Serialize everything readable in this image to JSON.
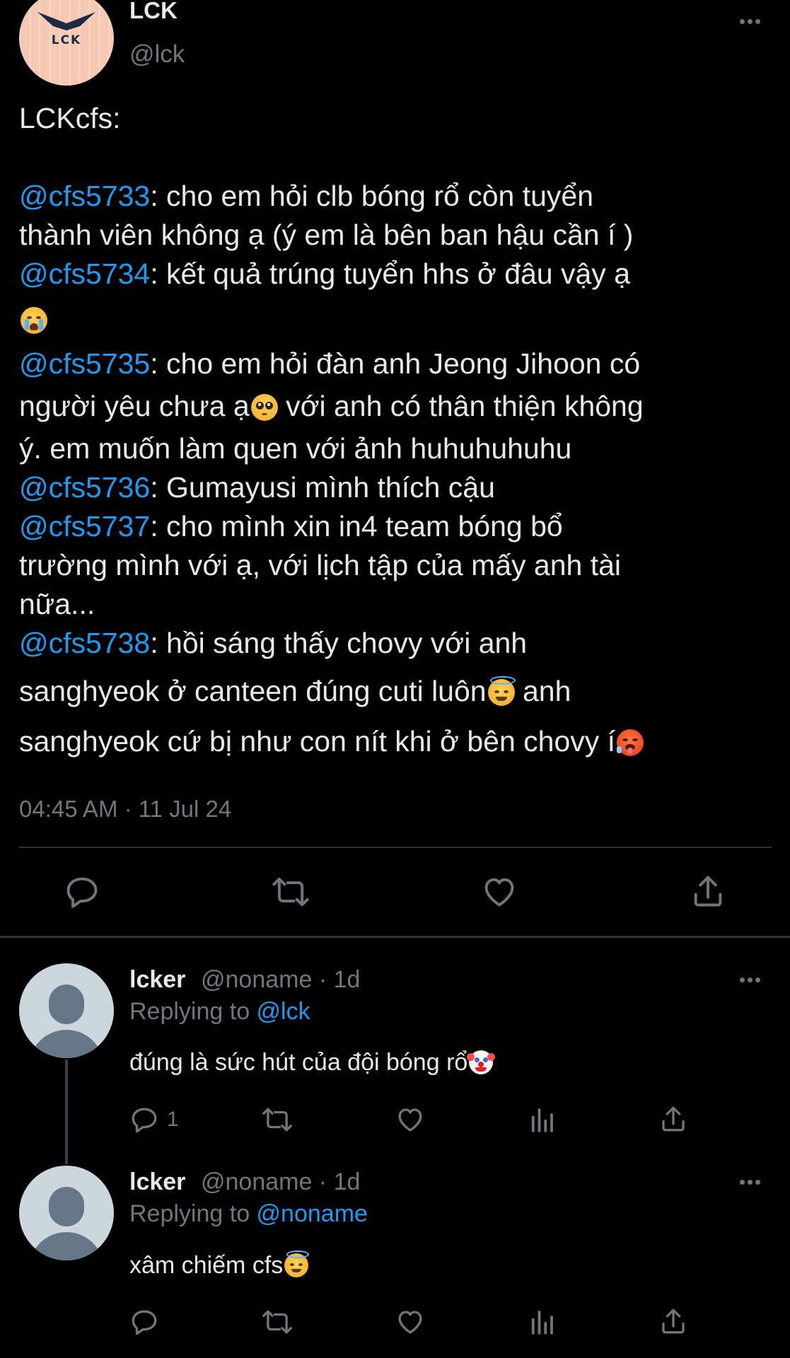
{
  "main_tweet": {
    "avatar_text": "LCK",
    "name": "LCK",
    "handle": "@lck",
    "header": "LCKcfs:",
    "lines": [
      {
        "mention": "@cfs5733",
        "text": ": cho em hỏi clb bóng rổ còn tuyển"
      },
      {
        "text": "thành viên không ạ (ý em là bên ban hậu cần í )"
      },
      {
        "mention": "@cfs5734",
        "text": ": kết quả trúng tuyển hhs ở đâu vậy ạ"
      },
      {
        "mention": "@cfs5735",
        "text": ": cho em hỏi đàn anh Jeong Jihoon có"
      },
      {
        "text": "người yêu chưa ạ",
        "text2": " với anh có thân thiện không"
      },
      {
        "text": "ý. em muốn làm quen với ảnh huhuhuhuhu"
      },
      {
        "mention": "@cfs5736",
        "text": ": Gumayusi mình thích cậu"
      },
      {
        "mention": "@cfs5737",
        "text": ": cho mình xin in4 team bóng bổ"
      },
      {
        "text": "trường mình với ạ, với lịch tập của mấy anh tài"
      },
      {
        "text": "nữa..."
      },
      {
        "mention": "@cfs5738",
        "text": ": hồi sáng thấy chovy với anh"
      },
      {
        "text": "sanghyeok ở canteen đúng cuti luôn",
        "text2": " anh"
      },
      {
        "text": "sanghyeok cứ bị như con nít khi ở bên chovy í"
      }
    ],
    "timestamp": "04:45 AM · 11 Jul 24",
    "icons": {
      "reply": "reply-icon",
      "retweet": "retweet-icon",
      "like": "like-icon",
      "share": "share-icon"
    }
  },
  "replies": [
    {
      "name": "lcker",
      "meta": "@noname · 1d",
      "replying_prefix": "Replying to ",
      "replying_to": "@lck",
      "text": "đúng là sức hút của đội bóng rổ",
      "reply_count": "1"
    },
    {
      "name": "lcker",
      "meta": "@noname · 1d",
      "replying_prefix": "Replying to ",
      "replying_to": "@noname",
      "text": "xâm chiếm cfs",
      "reply_count": ""
    }
  ],
  "colors": {
    "background": "#000000",
    "text": "#e7e9ea",
    "muted": "#71767b",
    "mention": "#1d9bf0",
    "divider": "#2f3336"
  }
}
